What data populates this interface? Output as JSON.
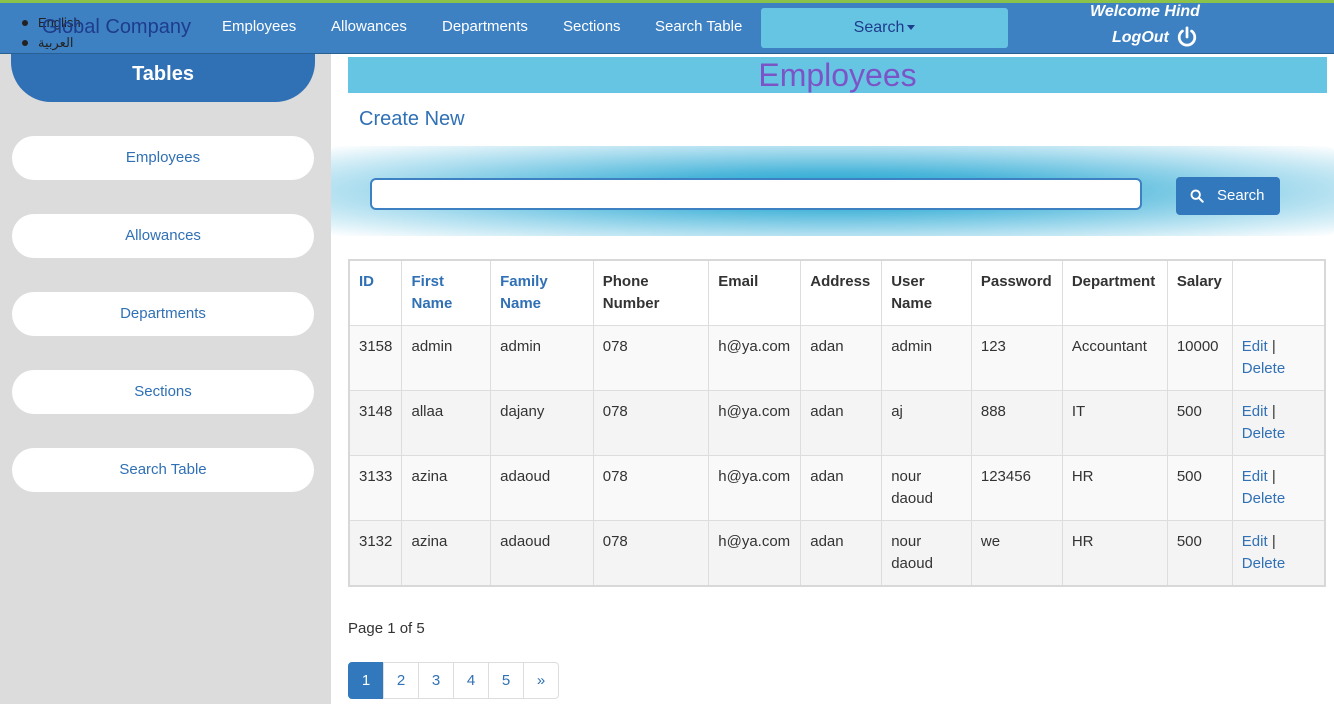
{
  "header": {
    "languages": [
      "English",
      "العربية"
    ],
    "brand": "Global Company",
    "nav": [
      "Employees",
      "Allowances",
      "Departments",
      "Sections",
      "Search Table"
    ],
    "search_label": "Search",
    "welcome": "Welcome Hind",
    "logout": "LogOut"
  },
  "sidebar": {
    "title": "Tables",
    "items": [
      "Employees",
      "Allowances",
      "Departments",
      "Sections",
      "Search Table"
    ]
  },
  "main": {
    "title": "Employees",
    "create_new": "Create New",
    "search_input_value": "",
    "search_button": "Search",
    "table": {
      "headers": [
        "ID",
        "First Name",
        "Family Name",
        "Phone Number",
        "Email",
        "Address",
        "User Name",
        "Password",
        "Department",
        "Salary"
      ],
      "rows": [
        [
          "3158",
          "admin",
          "admin",
          "078",
          "h@ya.com",
          "adan",
          "admin",
          "123",
          "Accountant",
          "10000"
        ],
        [
          "3148",
          "allaa",
          "dajany",
          "078",
          "h@ya.com",
          "adan",
          "aj",
          "888",
          "IT",
          "500"
        ],
        [
          "3133",
          "azina",
          "adaoud",
          "078",
          "h@ya.com",
          "adan",
          "nour daoud",
          "123456",
          "HR",
          "500"
        ],
        [
          "3132",
          "azina",
          "adaoud",
          "078",
          "h@ya.com",
          "adan",
          "nour daoud",
          "we",
          "HR",
          "500"
        ]
      ],
      "edit_label": "Edit",
      "separator": "|",
      "delete_label": "Delete"
    },
    "page_info": "Page 1 of 5",
    "pages": [
      "1",
      "2",
      "3",
      "4",
      "5",
      "»"
    ],
    "active_page": "1"
  },
  "colors": {
    "nav_bg": "#3d81c3",
    "accent_green": "#8bc34a",
    "title_bar": "#67c5e4",
    "title_text": "#7b55c7",
    "link": "#3070b5"
  }
}
